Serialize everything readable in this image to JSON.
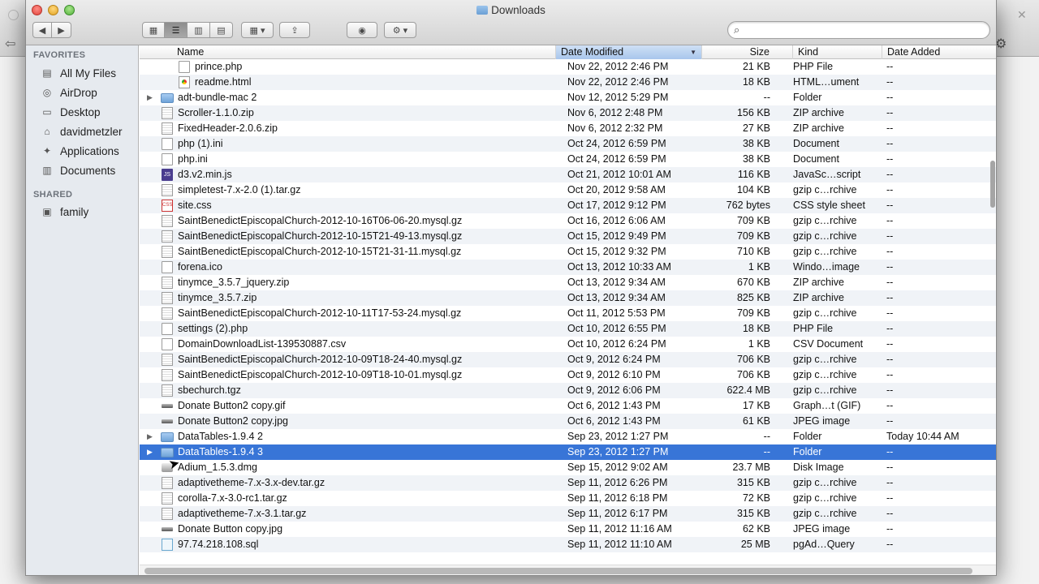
{
  "window": {
    "title": "Downloads"
  },
  "toolbar": {
    "back_icon": "back-arrow-icon",
    "forward_icon": "forward-arrow-icon",
    "search_placeholder": ""
  },
  "sidebar": {
    "favorites_header": "FAVORITES",
    "favorites": [
      {
        "label": "All My Files",
        "icon": "all-files-icon"
      },
      {
        "label": "AirDrop",
        "icon": "airdrop-icon"
      },
      {
        "label": "Desktop",
        "icon": "desktop-icon"
      },
      {
        "label": "davidmetzler",
        "icon": "home-icon"
      },
      {
        "label": "Applications",
        "icon": "applications-icon"
      },
      {
        "label": "Documents",
        "icon": "documents-icon"
      }
    ],
    "shared_header": "SHARED",
    "shared": [
      {
        "label": "family",
        "icon": "network-computer-icon"
      }
    ]
  },
  "columns": {
    "name": "Name",
    "date_modified": "Date Modified",
    "size": "Size",
    "kind": "Kind",
    "date_added": "Date Added"
  },
  "files": [
    {
      "name": "prince.php",
      "date": "Nov 22, 2012 2:46 PM",
      "size": "21 KB",
      "kind": "PHP File",
      "added": "--",
      "icon": "doc",
      "indent": true
    },
    {
      "name": "readme.html",
      "date": "Nov 22, 2012 2:46 PM",
      "size": "18 KB",
      "kind": "HTML…ument",
      "added": "--",
      "icon": "html",
      "indent": true
    },
    {
      "name": "adt-bundle-mac 2",
      "date": "Nov 12, 2012 5:29 PM",
      "size": "--",
      "kind": "Folder",
      "added": "--",
      "icon": "folder",
      "disclosure": true
    },
    {
      "name": "Scroller-1.1.0.zip",
      "date": "Nov 6, 2012 2:48 PM",
      "size": "156 KB",
      "kind": "ZIP archive",
      "added": "--",
      "icon": "zip"
    },
    {
      "name": "FixedHeader-2.0.6.zip",
      "date": "Nov 6, 2012 2:32 PM",
      "size": "27 KB",
      "kind": "ZIP archive",
      "added": "--",
      "icon": "zip"
    },
    {
      "name": "php (1).ini",
      "date": "Oct 24, 2012 6:59 PM",
      "size": "38 KB",
      "kind": "Document",
      "added": "--",
      "icon": "doc"
    },
    {
      "name": "php.ini",
      "date": "Oct 24, 2012 6:59 PM",
      "size": "38 KB",
      "kind": "Document",
      "added": "--",
      "icon": "doc"
    },
    {
      "name": "d3.v2.min.js",
      "date": "Oct 21, 2012 10:01 AM",
      "size": "116 KB",
      "kind": "JavaSc…script",
      "added": "--",
      "icon": "js"
    },
    {
      "name": "simpletest-7.x-2.0 (1).tar.gz",
      "date": "Oct 20, 2012 9:58 AM",
      "size": "104 KB",
      "kind": "gzip c…rchive",
      "added": "--",
      "icon": "zip"
    },
    {
      "name": "site.css",
      "date": "Oct 17, 2012 9:12 PM",
      "size": "762 bytes",
      "kind": "CSS style sheet",
      "added": "--",
      "icon": "css"
    },
    {
      "name": "SaintBenedictEpiscopalChurch-2012-10-16T06-06-20.mysql.gz",
      "date": "Oct 16, 2012 6:06 AM",
      "size": "709 KB",
      "kind": "gzip c…rchive",
      "added": "--",
      "icon": "zip"
    },
    {
      "name": "SaintBenedictEpiscopalChurch-2012-10-15T21-49-13.mysql.gz",
      "date": "Oct 15, 2012 9:49 PM",
      "size": "709 KB",
      "kind": "gzip c…rchive",
      "added": "--",
      "icon": "zip"
    },
    {
      "name": "SaintBenedictEpiscopalChurch-2012-10-15T21-31-11.mysql.gz",
      "date": "Oct 15, 2012 9:32 PM",
      "size": "710 KB",
      "kind": "gzip c…rchive",
      "added": "--",
      "icon": "zip"
    },
    {
      "name": "forena.ico",
      "date": "Oct 13, 2012 10:33 AM",
      "size": "1 KB",
      "kind": "Windo…image",
      "added": "--",
      "icon": "doc"
    },
    {
      "name": "tinymce_3.5.7_jquery.zip",
      "date": "Oct 13, 2012 9:34 AM",
      "size": "670 KB",
      "kind": "ZIP archive",
      "added": "--",
      "icon": "zip"
    },
    {
      "name": "tinymce_3.5.7.zip",
      "date": "Oct 13, 2012 9:34 AM",
      "size": "825 KB",
      "kind": "ZIP archive",
      "added": "--",
      "icon": "zip"
    },
    {
      "name": "SaintBenedictEpiscopalChurch-2012-10-11T17-53-24.mysql.gz",
      "date": "Oct 11, 2012 5:53 PM",
      "size": "709 KB",
      "kind": "gzip c…rchive",
      "added": "--",
      "icon": "zip"
    },
    {
      "name": "settings (2).php",
      "date": "Oct 10, 2012 6:55 PM",
      "size": "18 KB",
      "kind": "PHP File",
      "added": "--",
      "icon": "doc"
    },
    {
      "name": "DomainDownloadList-139530887.csv",
      "date": "Oct 10, 2012 6:24 PM",
      "size": "1 KB",
      "kind": "CSV Document",
      "added": "--",
      "icon": "doc"
    },
    {
      "name": "SaintBenedictEpiscopalChurch-2012-10-09T18-24-40.mysql.gz",
      "date": "Oct 9, 2012 6:24 PM",
      "size": "706 KB",
      "kind": "gzip c…rchive",
      "added": "--",
      "icon": "zip"
    },
    {
      "name": "SaintBenedictEpiscopalChurch-2012-10-09T18-10-01.mysql.gz",
      "date": "Oct 9, 2012 6:10 PM",
      "size": "706 KB",
      "kind": "gzip c…rchive",
      "added": "--",
      "icon": "zip"
    },
    {
      "name": "sbechurch.tgz",
      "date": "Oct 9, 2012 6:06 PM",
      "size": "622.4 MB",
      "kind": "gzip c…rchive",
      "added": "--",
      "icon": "zip"
    },
    {
      "name": "Donate Button2 copy.gif",
      "date": "Oct 6, 2012 1:43 PM",
      "size": "17 KB",
      "kind": "Graph…t (GIF)",
      "added": "--",
      "icon": "img"
    },
    {
      "name": "Donate Button2 copy.jpg",
      "date": "Oct 6, 2012 1:43 PM",
      "size": "61 KB",
      "kind": "JPEG image",
      "added": "--",
      "icon": "img"
    },
    {
      "name": "DataTables-1.9.4 2",
      "date": "Sep 23, 2012 1:27 PM",
      "size": "--",
      "kind": "Folder",
      "added": "Today 10:44 AM",
      "icon": "folder",
      "disclosure": true
    },
    {
      "name": "DataTables-1.9.4 3",
      "date": "Sep 23, 2012 1:27 PM",
      "size": "--",
      "kind": "Folder",
      "added": "--",
      "icon": "folder",
      "disclosure": true,
      "selected": true
    },
    {
      "name": "Adium_1.5.3.dmg",
      "date": "Sep 15, 2012 9:02 AM",
      "size": "23.7 MB",
      "kind": "Disk Image",
      "added": "--",
      "icon": "dmg"
    },
    {
      "name": "adaptivetheme-7.x-3.x-dev.tar.gz",
      "date": "Sep 11, 2012 6:26 PM",
      "size": "315 KB",
      "kind": "gzip c…rchive",
      "added": "--",
      "icon": "zip"
    },
    {
      "name": "corolla-7.x-3.0-rc1.tar.gz",
      "date": "Sep 11, 2012 6:18 PM",
      "size": "72 KB",
      "kind": "gzip c…rchive",
      "added": "--",
      "icon": "zip"
    },
    {
      "name": "adaptivetheme-7.x-3.1.tar.gz",
      "date": "Sep 11, 2012 6:17 PM",
      "size": "315 KB",
      "kind": "gzip c…rchive",
      "added": "--",
      "icon": "zip"
    },
    {
      "name": "Donate Button copy.jpg",
      "date": "Sep 11, 2012 11:16 AM",
      "size": "62 KB",
      "kind": "JPEG image",
      "added": "--",
      "icon": "img"
    },
    {
      "name": "97.74.218.108.sql",
      "date": "Sep 11, 2012 11:10 AM",
      "size": "25 MB",
      "kind": "pgAd…Query",
      "added": "--",
      "icon": "sql"
    }
  ],
  "colors": {
    "selection": "#3875d7",
    "sorted_header": "#a8c6ec",
    "sidebar_bg": "#e6eaef"
  }
}
